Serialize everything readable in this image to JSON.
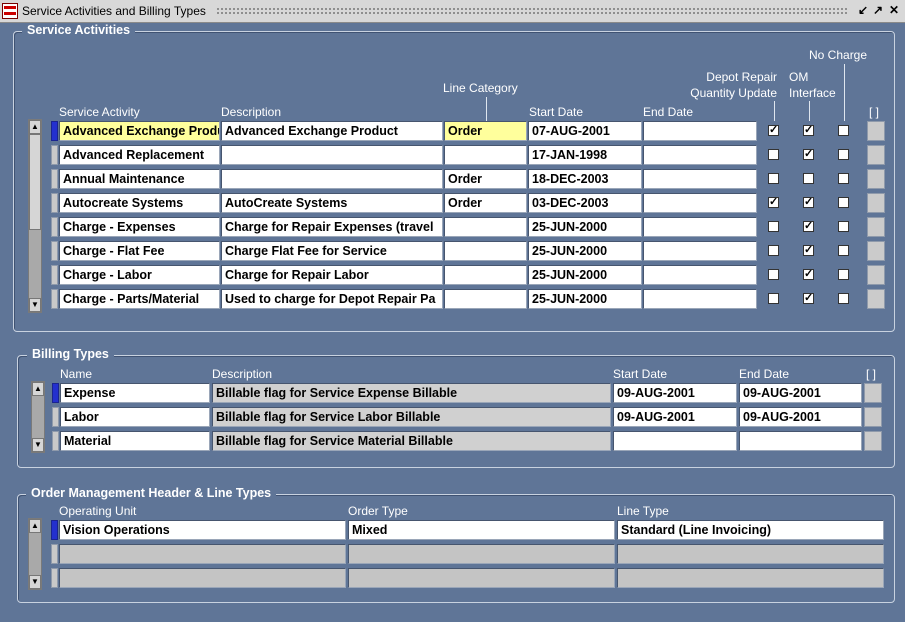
{
  "window": {
    "title": "Service Activities and Billing Types",
    "minimize_icon": "minimize-icon",
    "maximize_icon": "restore-icon",
    "close_icon": "close-icon"
  },
  "service_activities": {
    "title": "Service Activities",
    "headers": {
      "service_activity": "Service Activity",
      "description": "Description",
      "line_category": "Line Category",
      "start_date": "Start Date",
      "end_date": "End Date",
      "depot_repair_1": "Depot Repair",
      "depot_repair_2": "Quantity Update",
      "om_1": "OM",
      "om_2": "Interface",
      "no_charge": "No Charge",
      "dff": "[ ]"
    },
    "rows": [
      {
        "activity": "Advanced Exchange Product",
        "description": "Advanced Exchange Product",
        "line_category": "Order",
        "start_date": "07-AUG-2001",
        "end_date": "",
        "depot": true,
        "om": true,
        "no_charge": false
      },
      {
        "activity": "Advanced Replacement",
        "description": "",
        "line_category": "",
        "start_date": "17-JAN-1998",
        "end_date": "",
        "depot": false,
        "om": true,
        "no_charge": false
      },
      {
        "activity": "Annual Maintenance",
        "description": "",
        "line_category": "Order",
        "start_date": "18-DEC-2003",
        "end_date": "",
        "depot": false,
        "om": false,
        "no_charge": false
      },
      {
        "activity": "Autocreate Systems",
        "description": "AutoCreate Systems",
        "line_category": "Order",
        "start_date": "03-DEC-2003",
        "end_date": "",
        "depot": true,
        "om": true,
        "no_charge": false
      },
      {
        "activity": "Charge - Expenses",
        "description": "Charge for Repair Expenses (travel",
        "line_category": "",
        "start_date": "25-JUN-2000",
        "end_date": "",
        "depot": false,
        "om": true,
        "no_charge": false
      },
      {
        "activity": "Charge - Flat Fee",
        "description": "Charge Flat Fee for Service",
        "line_category": "",
        "start_date": "25-JUN-2000",
        "end_date": "",
        "depot": false,
        "om": true,
        "no_charge": false
      },
      {
        "activity": "Charge - Labor",
        "description": "Charge for Repair Labor",
        "line_category": "",
        "start_date": "25-JUN-2000",
        "end_date": "",
        "depot": false,
        "om": true,
        "no_charge": false
      },
      {
        "activity": "Charge - Parts/Material",
        "description": "Used to charge for Depot Repair Pa",
        "line_category": "",
        "start_date": "25-JUN-2000",
        "end_date": "",
        "depot": false,
        "om": true,
        "no_charge": false
      }
    ]
  },
  "billing_types": {
    "title": "Billing Types",
    "headers": {
      "name": "Name",
      "description": "Description",
      "start_date": "Start Date",
      "end_date": "End Date",
      "dff": "[ ]"
    },
    "rows": [
      {
        "name": "Expense",
        "description": "Billable flag for Service Expense Billable",
        "start_date": "09-AUG-2001",
        "end_date": "09-AUG-2001"
      },
      {
        "name": "Labor",
        "description": "Billable flag for Service Labor Billable",
        "start_date": "09-AUG-2001",
        "end_date": "09-AUG-2001"
      },
      {
        "name": "Material",
        "description": "Billable flag for Service Material Billable",
        "start_date": "",
        "end_date": ""
      }
    ]
  },
  "om_types": {
    "title": "Order Management Header & Line Types",
    "headers": {
      "operating_unit": "Operating Unit",
      "order_type": "Order Type",
      "line_type": "Line Type"
    },
    "rows": [
      {
        "operating_unit": "Vision Operations",
        "order_type": "Mixed",
        "line_type": "Standard (Line Invoicing)"
      },
      {
        "operating_unit": "",
        "order_type": "",
        "line_type": ""
      },
      {
        "operating_unit": "",
        "order_type": "",
        "line_type": ""
      }
    ]
  },
  "colors": {
    "background": "#5f7597",
    "current_record": "#2330cf",
    "highlight_field": "#ffff9c"
  }
}
